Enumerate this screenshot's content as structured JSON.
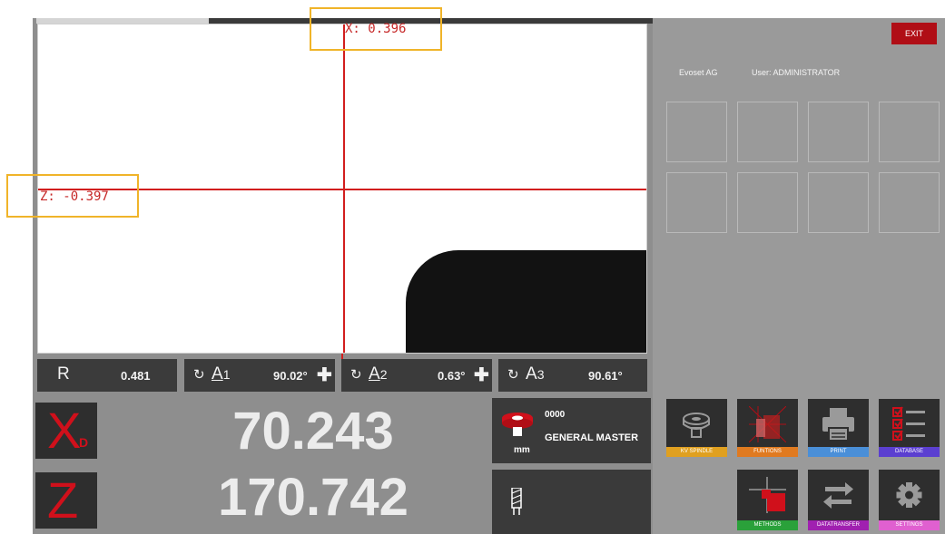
{
  "camera": {
    "x_readout": "X: 0.396",
    "z_readout": "Z: -0.397"
  },
  "angles": {
    "r_label": "R",
    "r_value": "0.481",
    "a1_label": "A",
    "a1_index": "1",
    "a1_value": "90.02°",
    "a2_label": "A",
    "a2_index": "2",
    "a2_value": "0.63°",
    "a3_label": "A",
    "a3_index": "3",
    "a3_value": "90.61°",
    "rotate_symbol": "↻",
    "plus_symbol": "✚"
  },
  "axes": {
    "x_letter": "X",
    "x_sub": "D",
    "x_value": "70.243",
    "z_letter": "Z",
    "z_value": "170.742"
  },
  "tool": {
    "number": "0000",
    "name": "GENERAL MASTER",
    "unit": "mm"
  },
  "header": {
    "exit_label": "EXIT",
    "company": "Evoset AG",
    "user": "User: ADMINISTRATOR"
  },
  "functions": [
    {
      "label": "KV SPINDLE",
      "color": "#e0a020",
      "icon": "spindle-icon"
    },
    {
      "label": "FUNTIONS",
      "color": "#e07a20",
      "icon": "functions-icon"
    },
    {
      "label": "PRINT",
      "color": "#4a8fd8",
      "icon": "printer-icon"
    },
    {
      "label": "DATABASE",
      "color": "#5b3fd0",
      "icon": "checklist-icon"
    },
    {
      "label": "METHODS",
      "color": "#2aa13a",
      "icon": "methods-icon"
    },
    {
      "label": "DATATRANSFER",
      "color": "#a020b0",
      "icon": "transfer-arrows-icon"
    },
    {
      "label": "SETTINGS",
      "color": "#e060d0",
      "icon": "gear-icon"
    }
  ],
  "colors": {
    "accent_red": "#d0101b",
    "crosshair": "#d21e1e",
    "panel_dark": "#2e2e2e",
    "panel_gray": "#9a9a9a"
  }
}
